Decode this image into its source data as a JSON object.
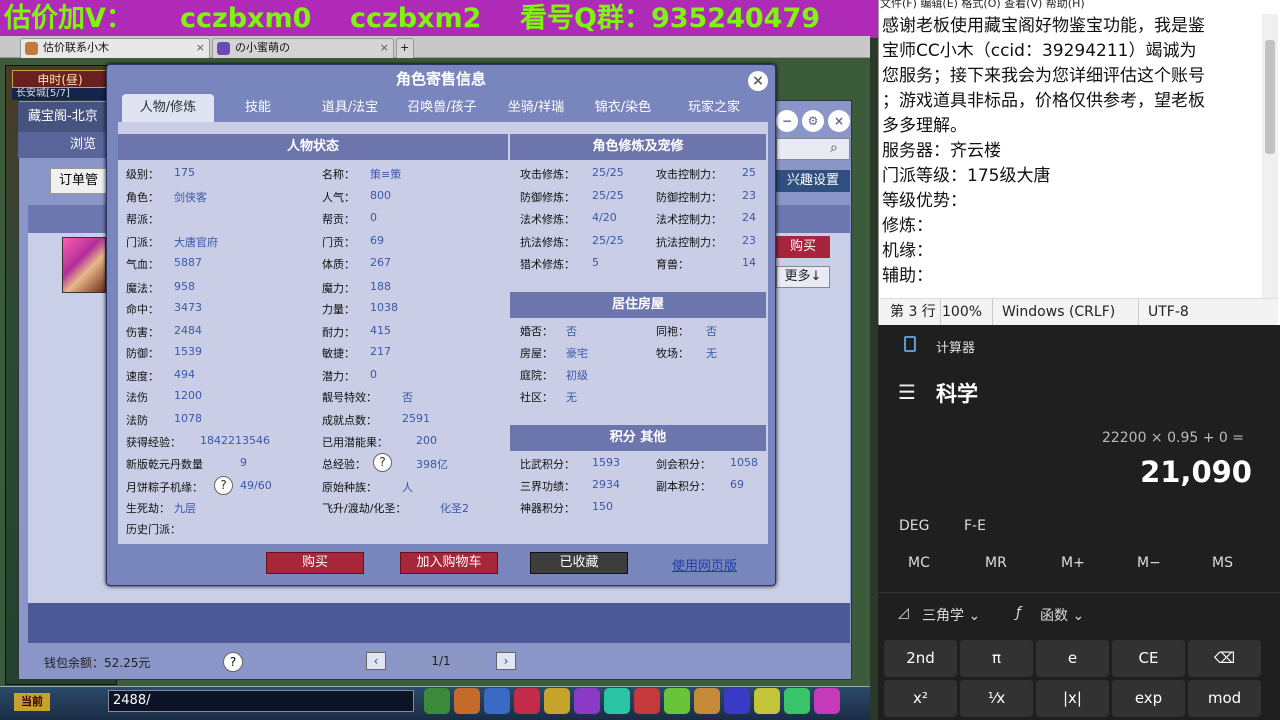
{
  "banner": {
    "parts": [
      "估价加V：",
      "cczbxm0",
      "cczbxm2",
      "看号Q群：935240479"
    ]
  },
  "browser_tabs": [
    {
      "label": "估价联系小木"
    },
    {
      "label": "の小蜜萌の"
    }
  ],
  "game": {
    "side_header": "申时(昼)",
    "side_sub": "长安城[5/7]",
    "outer_title": "藏宝阁-北京",
    "outer_nav": "浏览",
    "order_btn": "订单管",
    "right_setting": "兴趣设置",
    "right_buy": "购买",
    "right_more": "更多↓",
    "wallet": "钱包余额：52.25元",
    "page": "1/1",
    "bottom_current": "当前",
    "chat_input": "2488/"
  },
  "dialog": {
    "title": "角色寄售信息",
    "tabs": [
      "人物/修炼",
      "技能",
      "道具/法宝",
      "召唤兽/孩子",
      "坐骑/祥瑞",
      "锦衣/染色",
      "玩家之家"
    ],
    "active_tab": 0,
    "sections": {
      "status": "人物状态",
      "cultivation": "角色修炼及宠修",
      "house": "居住房屋",
      "points": "积分 其他"
    },
    "status_left": [
      [
        "级别：",
        "175"
      ],
      [
        "角色：",
        "剑侠客"
      ],
      [
        "帮派：",
        ""
      ],
      [
        "门派：",
        "大唐官府"
      ],
      [
        "气血：",
        "5887"
      ],
      [
        "魔法：",
        "958"
      ],
      [
        "命中：",
        "3473"
      ],
      [
        "伤害：",
        "2484"
      ],
      [
        "防御：",
        "1539"
      ],
      [
        "速度：",
        "494"
      ],
      [
        "法伤",
        "1200"
      ],
      [
        "法防",
        "1078"
      ],
      [
        "获得经验：",
        "1842213546"
      ],
      [
        "新版乾元丹数量",
        "9"
      ],
      [
        "月饼粽子机缘：",
        "49/60"
      ],
      [
        "生死劫：",
        "九层"
      ],
      [
        "历史门派：",
        ""
      ]
    ],
    "status_right": [
      [
        "名称：",
        "策≡策"
      ],
      [
        "人气：",
        "800"
      ],
      [
        "帮贡：",
        "0"
      ],
      [
        "门贡：",
        "69"
      ],
      [
        "体质：",
        "267"
      ],
      [
        "魔力：",
        "188"
      ],
      [
        "力量：",
        "1038"
      ],
      [
        "耐力：",
        "415"
      ],
      [
        "敏捷：",
        "217"
      ],
      [
        "潜力：",
        "0"
      ],
      [
        "靓号特效：",
        "否"
      ],
      [
        "成就点数：",
        "2591"
      ],
      [
        "已用潜能果：",
        "200"
      ],
      [
        "总经验：",
        "398亿"
      ],
      [
        "原始种族：",
        "人"
      ],
      [
        "飞升/渡劫/化圣：",
        "化圣2"
      ]
    ],
    "cultivation": [
      [
        "攻击修炼：",
        "25/25",
        "攻击控制力：",
        "25"
      ],
      [
        "防御修炼：",
        "25/25",
        "防御控制力：",
        "23"
      ],
      [
        "法术修炼：",
        "4/20",
        "法术控制力：",
        "24"
      ],
      [
        "抗法修炼：",
        "25/25",
        "抗法控制力：",
        "23"
      ],
      [
        "猎术修炼：",
        "5",
        "育兽：",
        "14"
      ]
    ],
    "house": [
      [
        "婚否：",
        "否",
        "同袍：",
        "否"
      ],
      [
        "房屋：",
        "豪宅",
        "牧场：",
        "无"
      ],
      [
        "庭院：",
        "初级",
        "",
        ""
      ],
      [
        "社区：",
        "无",
        "",
        ""
      ]
    ],
    "points": [
      [
        "比武积分：",
        "1593",
        "剑会积分：",
        "1058"
      ],
      [
        "三界功绩：",
        "2934",
        "副本积分：",
        "69"
      ],
      [
        "神器积分：",
        "150",
        "",
        ""
      ]
    ],
    "btn_buy": "购买",
    "btn_cart": "加入购物车",
    "btn_fav": "已收藏",
    "web_link": "使用网页版"
  },
  "notepad": {
    "menu": "文件(F)   编辑(E)   格式(O)   查看(V)   帮助(H)",
    "text": "感谢老板使用藏宝阁好物鉴宝功能，我是鉴\n宝师CC小木（ccid：39294211）竭诚为\n您服务；接下来我会为您详细评估这个账号\n；游戏道具非标品，价格仅供参考，望老板\n多多理解。\n服务器：齐云楼\n门派等级：175级大唐\n等级优势：\n修炼：\n机缘：\n辅助：",
    "status": [
      "第 3 行",
      "100%",
      "Windows (CRLF)",
      "UTF-8"
    ]
  },
  "calculator": {
    "title": "计算器",
    "mode": "科学",
    "expression": "22200 × 0.95 + 0 =",
    "result": "21,090",
    "row_modes": [
      "DEG",
      "F-E"
    ],
    "memory": [
      "MC",
      "MR",
      "M+",
      "M−",
      "MS"
    ],
    "dropdowns": [
      "三角学",
      "函数"
    ],
    "row1": [
      "2nd",
      "π",
      "e",
      "CE",
      "⌫"
    ],
    "row2": [
      "x²",
      "¹⁄x",
      "|x|",
      "exp",
      "mod"
    ]
  }
}
